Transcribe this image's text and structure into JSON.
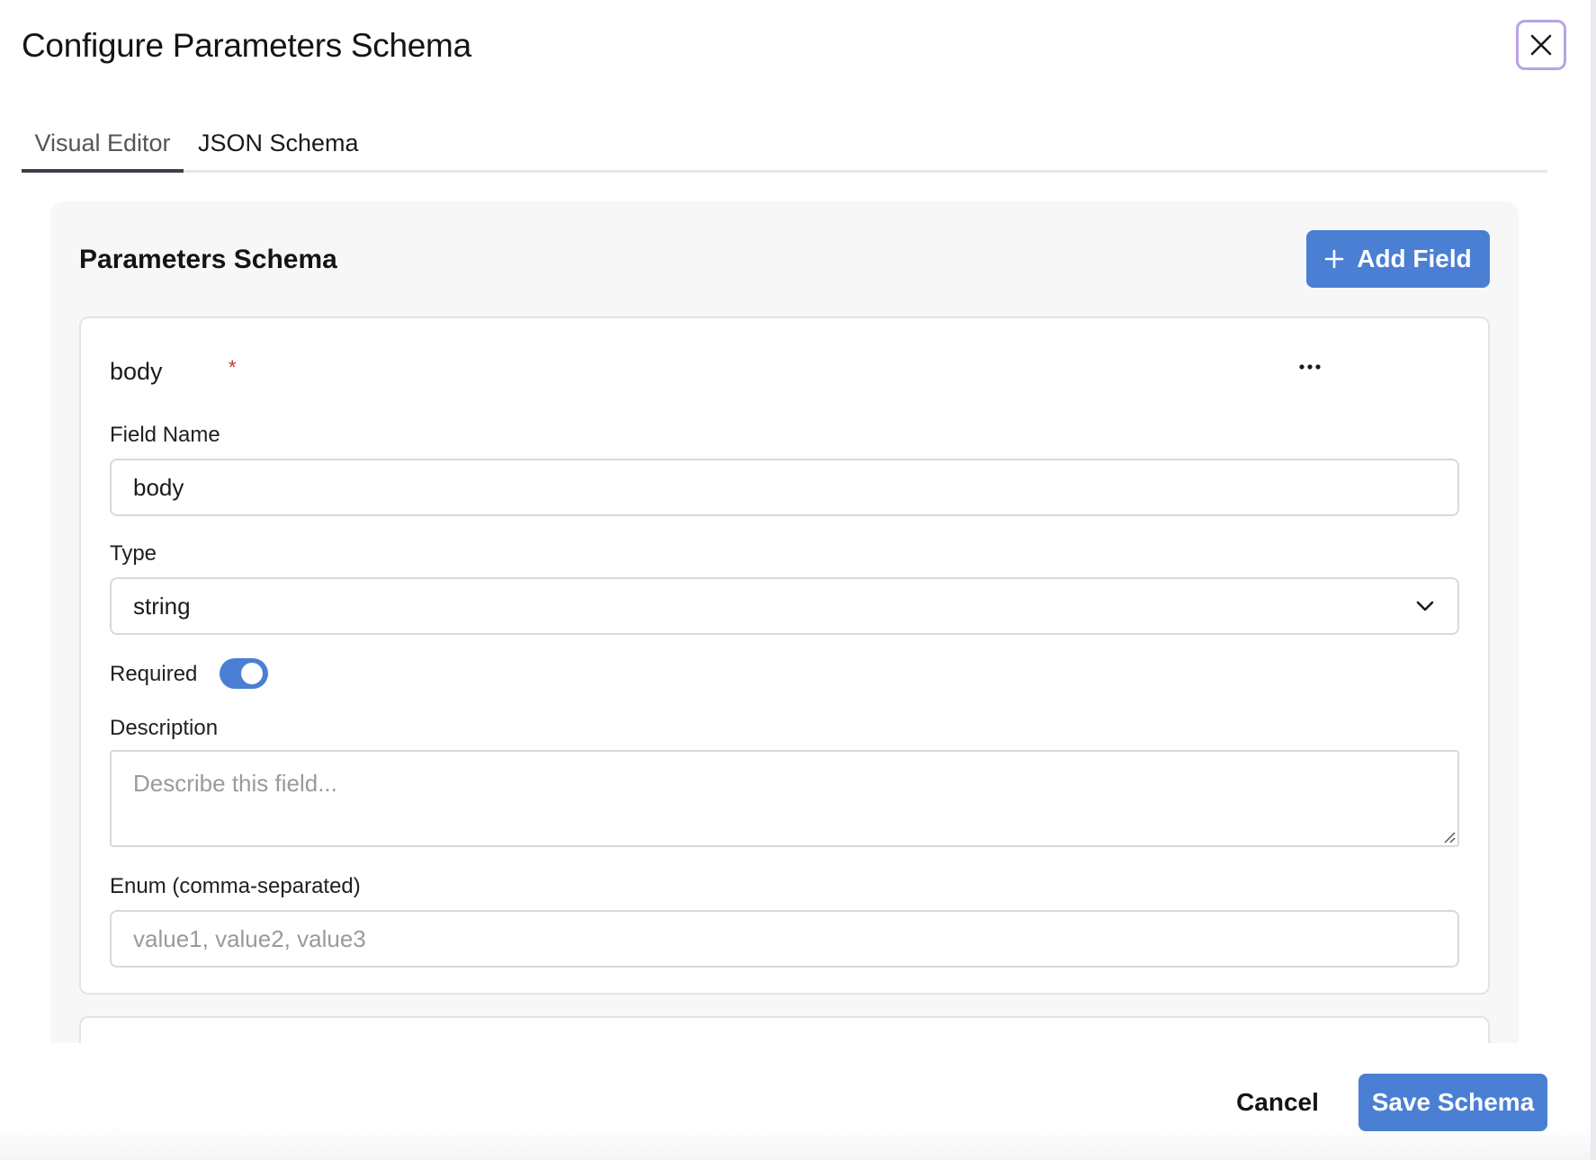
{
  "modal": {
    "title": "Configure Parameters Schema"
  },
  "tabs": [
    {
      "label": "Visual Editor",
      "active": true
    },
    {
      "label": "JSON Schema",
      "active": false
    }
  ],
  "panel": {
    "title": "Parameters Schema",
    "add_field_label": "Add Field"
  },
  "field": {
    "header_name": "body",
    "required_marker": "*",
    "name_label": "Field Name",
    "name_value": "body",
    "type_label": "Type",
    "type_value": "string",
    "required_label": "Required",
    "required_on": true,
    "description_label": "Description",
    "description_placeholder": "Describe this field...",
    "enum_label": "Enum (comma-separated)",
    "enum_placeholder": "value1, value2, value3"
  },
  "footer": {
    "cancel_label": "Cancel",
    "save_label": "Save Schema"
  },
  "colors": {
    "primary": "#4a7fd4",
    "required_star": "#c0392b",
    "focus_ring": "#b8a4e6"
  },
  "icons": [
    "close-icon",
    "plus-icon",
    "more-horizontal-icon",
    "chevron-down-icon",
    "resize-grip-icon"
  ]
}
